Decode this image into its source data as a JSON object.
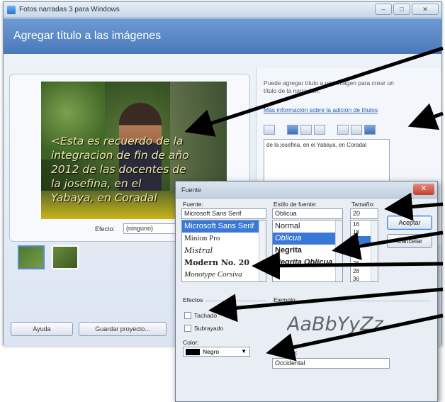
{
  "window": {
    "title": "Fotos narradas 3 para Windows",
    "btn_min": "–",
    "btn_max": "□",
    "btn_close": "✕"
  },
  "header": {
    "heading": "Agregar título a las imágenes"
  },
  "preview": {
    "caption_lines": [
      "<Esta es recuerdo de la",
      "integracion de fin de año",
      "2012 de las docentes de",
      "la josefina, en el",
      "Yabaya, en Coradal"
    ],
    "effect_label": "Efecto:",
    "effect_value": "(ninguno)"
  },
  "side": {
    "help_text": "Puede agregar título a una imagen para crear un título de la narración.",
    "more_link": "Más información sobre la adición de títulos",
    "text_value": "de la josefina, en el Yabaya, en Coradal"
  },
  "buttons": {
    "help": "Ayuda",
    "save": "Guardar proyecto..."
  },
  "font_dialog": {
    "title": "Fuente",
    "close": "✕",
    "font_label": "Fuente:",
    "font_value": "Microsoft Sans Serif",
    "fonts": [
      "Microsoft Sans Serif",
      "Minion Pro",
      "Mistral",
      "Modern No. 20",
      "Monotype Corsiva"
    ],
    "style_label": "Estilo de fuente:",
    "style_value": "Oblicua",
    "styles": [
      "Normal",
      "Oblicua",
      "Negrita",
      "Negrita Oblicua"
    ],
    "size_label": "Tamaño:",
    "size_value": "20",
    "sizes": [
      "16",
      "18",
      "20",
      "22",
      "24",
      "26",
      "28",
      "36"
    ],
    "accept": "Aceptar",
    "cancel": "Cancelar",
    "effects_label": "Efectos",
    "strike_label": "Tachado",
    "underline_label": "Subrayado",
    "color_label": "Color:",
    "color_value": "Negro",
    "sample_label": "Ejemplo",
    "sample_text": "AaBbYyZz",
    "script_label": "Alfabeto:",
    "script_value": "Occidental"
  },
  "colors": {
    "header": "#4a79bb",
    "selection": "#3a78d8",
    "arrow": "#000000"
  }
}
